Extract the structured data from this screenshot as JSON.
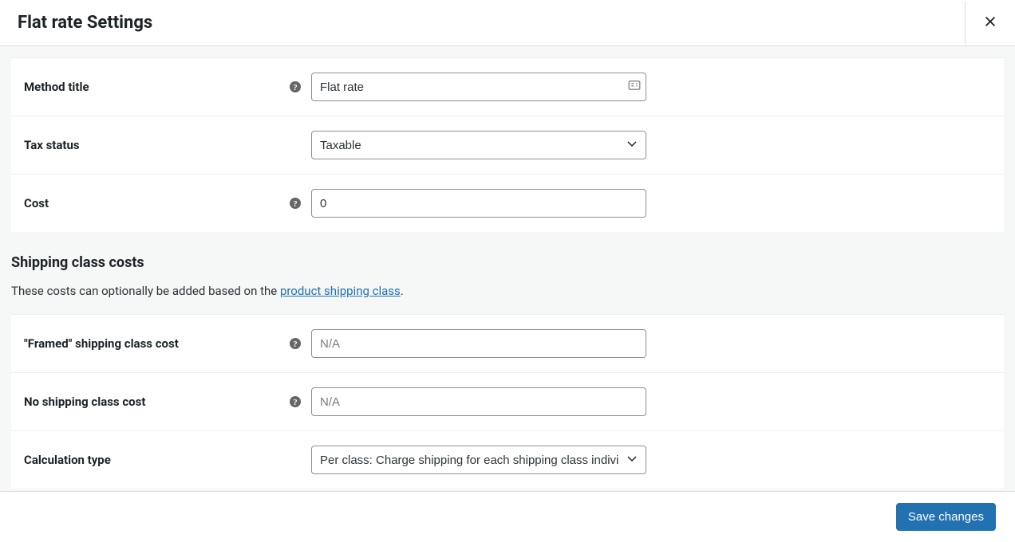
{
  "header": {
    "title": "Flat rate Settings"
  },
  "mainForm": {
    "methodTitle": {
      "label": "Method title",
      "value": "Flat rate"
    },
    "taxStatus": {
      "label": "Tax status",
      "value": "Taxable"
    },
    "cost": {
      "label": "Cost",
      "value": "0"
    }
  },
  "classCosts": {
    "heading": "Shipping class costs",
    "desc_pre": "These costs can optionally be added based on the ",
    "desc_link": "product shipping class",
    "desc_post": ".",
    "framed": {
      "label": "\"Framed\" shipping class cost",
      "placeholder": "N/A",
      "value": ""
    },
    "noClass": {
      "label": "No shipping class cost",
      "placeholder": "N/A",
      "value": ""
    },
    "calcType": {
      "label": "Calculation type",
      "value": "Per class: Charge shipping for each shipping class individually"
    }
  },
  "footer": {
    "save": "Save changes"
  }
}
